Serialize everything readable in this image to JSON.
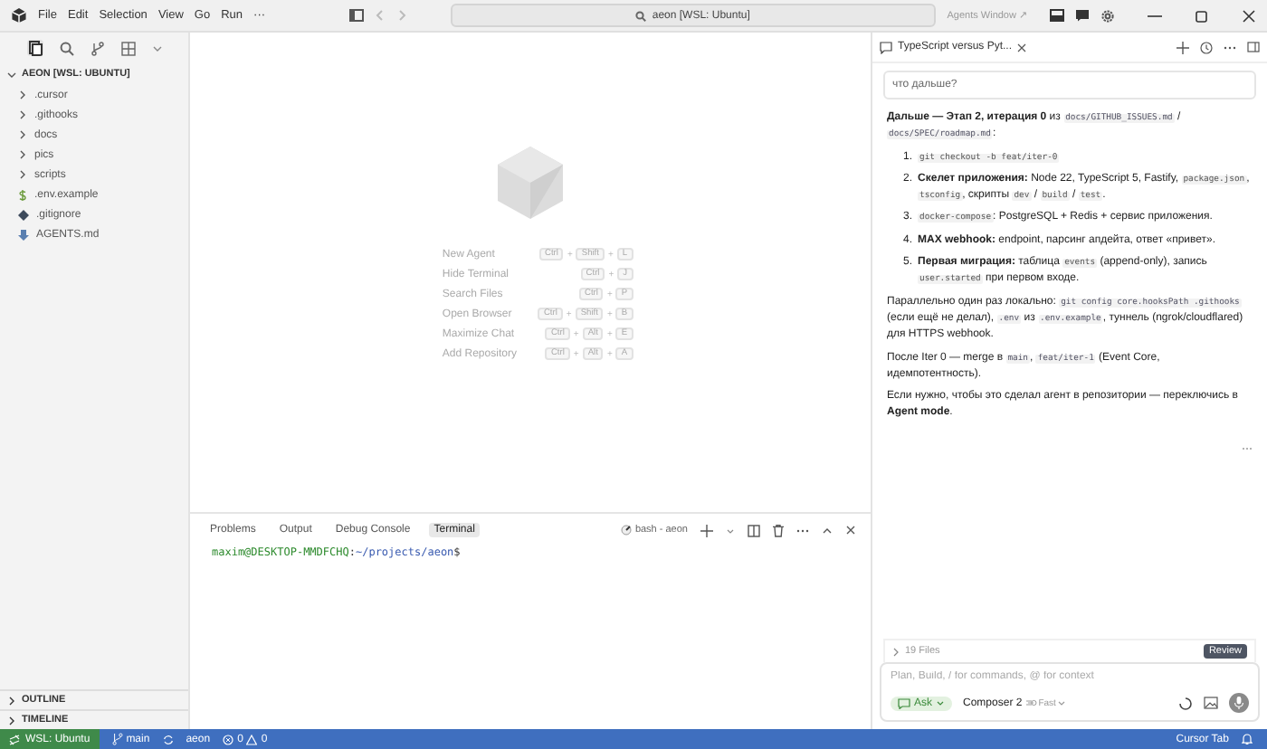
{
  "title_bar": {
    "menu": [
      "File",
      "Edit",
      "Selection",
      "View",
      "Go",
      "Run",
      "···"
    ],
    "search": "aeon [WSL: Ubuntu]",
    "agents_window": "Agents Window ↗"
  },
  "sidebar": {
    "root": {
      "label": "AEON [WSL: UBUNTU]",
      "expanded": true,
      "children": [
        {
          "label": ".cursor",
          "kind": "folder",
          "expanded": false
        },
        {
          "label": ".githooks",
          "kind": "folder",
          "expanded": false
        },
        {
          "label": "docs",
          "kind": "folder",
          "expanded": false
        },
        {
          "label": "pics",
          "kind": "folder",
          "expanded": false
        },
        {
          "label": "scripts",
          "kind": "folder",
          "expanded": false
        },
        {
          "label": ".env.example",
          "kind": "env"
        },
        {
          "label": ".gitignore",
          "kind": "git"
        },
        {
          "label": "AGENTS.md",
          "kind": "md"
        }
      ]
    },
    "sections": [
      {
        "label": "OUTLINE",
        "expanded": false
      },
      {
        "label": "TIMELINE",
        "expanded": false
      }
    ]
  },
  "editor": {
    "shortcuts": [
      {
        "label": "New Agent",
        "keys": [
          "Ctrl",
          "Shift",
          "L"
        ]
      },
      {
        "label": "Hide Terminal",
        "keys": [
          "Ctrl",
          "J"
        ]
      },
      {
        "label": "Search Files",
        "keys": [
          "Ctrl",
          "P"
        ]
      },
      {
        "label": "Open Browser",
        "keys": [
          "Ctrl",
          "Shift",
          "B"
        ]
      },
      {
        "label": "Maximize Chat",
        "keys": [
          "Ctrl",
          "Alt",
          "E"
        ]
      },
      {
        "label": "Add Repository",
        "keys": [
          "Ctrl",
          "Alt",
          "A"
        ]
      }
    ],
    "key_separator": "+"
  },
  "panel": {
    "tabs": [
      {
        "label": "Problems",
        "selected": false
      },
      {
        "label": "Output",
        "selected": false
      },
      {
        "label": "Debug Console",
        "selected": false
      },
      {
        "label": "Terminal",
        "selected": true
      }
    ],
    "terminal_name": "bash - aeon",
    "prompt": {
      "user": "maxim@DESKTOP-MMDFCHQ",
      "sep": ":",
      "path": "~/projects/aeon",
      "end": "$"
    }
  },
  "chat": {
    "tab": "TypeScript versus Pyt...",
    "user_message": "что дальше?",
    "blocks": [
      {
        "kind": "para",
        "parts": [
          {
            "kind": "text",
            "text": "**Дальше — Этап 2, итерация 0** из "
          },
          {
            "kind": "code",
            "text": "docs/GITHUB_ISSUES.md"
          },
          {
            "kind": "text",
            "text": " / "
          },
          {
            "kind": "code",
            "text": "docs/SPEC/roadmap.md"
          },
          {
            "kind": "text",
            "text": ":"
          }
        ]
      },
      {
        "kind": "item",
        "number": "1.",
        "parts": [
          {
            "kind": "code",
            "text": "git checkout -b feat/iter-0"
          }
        ]
      },
      {
        "kind": "item",
        "number": "2.",
        "parts": [
          {
            "kind": "text",
            "text": "**Скелет приложения:** Node 22, TypeScript 5, Fastify, "
          },
          {
            "kind": "code",
            "text": "package.json"
          },
          {
            "kind": "text",
            "text": ", "
          },
          {
            "kind": "code",
            "text": "tsconfig"
          },
          {
            "kind": "text",
            "text": ", скрипты "
          },
          {
            "kind": "code",
            "text": "dev"
          },
          {
            "kind": "text",
            "text": " / "
          },
          {
            "kind": "code",
            "text": "build"
          },
          {
            "kind": "text",
            "text": " / "
          },
          {
            "kind": "code",
            "text": "test"
          },
          {
            "kind": "text",
            "text": "."
          }
        ]
      },
      {
        "kind": "item",
        "number": "3.",
        "parts": [
          {
            "kind": "code",
            "text": "docker-compose"
          },
          {
            "kind": "text",
            "text": ": PostgreSQL + Redis + сервис приложения."
          }
        ]
      },
      {
        "kind": "item",
        "number": "4.",
        "parts": [
          {
            "kind": "text",
            "text": "**MAX webhook:** endpoint, парсинг апдейта, ответ «привет»."
          }
        ]
      },
      {
        "kind": "item",
        "number": "5.",
        "parts": [
          {
            "kind": "text",
            "text": "**Первая миграция:** таблица "
          },
          {
            "kind": "code",
            "text": "events"
          },
          {
            "kind": "text",
            "text": " (append-only), запись "
          },
          {
            "kind": "code",
            "text": "user.started"
          },
          {
            "kind": "text",
            "text": " при первом входе."
          }
        ]
      },
      {
        "kind": "para",
        "parts": [
          {
            "kind": "text",
            "text": "Параллельно один раз локально: "
          },
          {
            "kind": "code",
            "text": "git config core.hooksPath .githooks"
          },
          {
            "kind": "text",
            "text": " (если ещё не делал), "
          },
          {
            "kind": "code",
            "text": ".env"
          },
          {
            "kind": "text",
            "text": " из "
          },
          {
            "kind": "code",
            "text": ".env.example"
          },
          {
            "kind": "text",
            "text": ", туннель (ngrok/cloudflared) для HTTPS webhook."
          }
        ]
      },
      {
        "kind": "para",
        "parts": [
          {
            "kind": "text",
            "text": "После Iter 0 — merge в "
          },
          {
            "kind": "code",
            "text": "main"
          },
          {
            "kind": "text",
            "text": ", "
          },
          {
            "kind": "code",
            "text": "feat/iter-1"
          },
          {
            "kind": "text",
            "text": " (Event Core, идемпотентность)."
          }
        ]
      },
      {
        "kind": "para",
        "parts": [
          {
            "kind": "text",
            "text": "Если нужно, чтобы это сделал агент в репозитории — переключись в **Agent mode**."
          }
        ]
      }
    ],
    "files": "19 Files",
    "review": "Review",
    "placeholder": "Plan, Build, / for commands, @ for context",
    "mode": "Ask",
    "model": "Composer 2",
    "speed": "Fast"
  },
  "status_bar": {
    "remote": "WSL: Ubuntu",
    "branch": "main",
    "workspace": "aeon",
    "errors": "0",
    "warnings": "0",
    "right": "Cursor Tab"
  }
}
